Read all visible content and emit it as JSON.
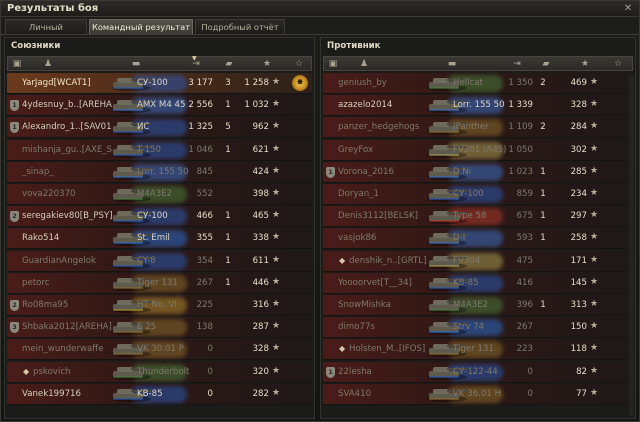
{
  "window": {
    "title": "Результаты боя",
    "close_glyph": "✕"
  },
  "tabs": [
    {
      "label": "Личный результат",
      "active": false
    },
    {
      "label": "Командный результат",
      "active": true
    },
    {
      "label": "Подробный отчёт",
      "active": false
    }
  ],
  "icons": {
    "platoon": "platoon-icon",
    "player": "player-icon",
    "tank": "tank-icon",
    "damage": "damage-icon",
    "kills": "kills-icon",
    "xp": "experience-star-icon",
    "star_glyph": "★",
    "medal": "medal-icon"
  },
  "colors": {
    "player_row": "#6b3a1c",
    "dead_row": "#4a1c18",
    "accent_text": "#e6dfc9",
    "tab_active": "#55534a"
  },
  "allies": {
    "title": "Союзники",
    "rows": [
      {
        "name": "YarJagd[WCAT1]",
        "platoon": "",
        "tank": "СУ-100",
        "nation": "ussr",
        "damage": "3 177",
        "kills": "3",
        "xp": "1 258",
        "player": true,
        "dead": false,
        "medal": true
      },
      {
        "name": "4ydesnuy_b..[AREHA]",
        "platoon": "1",
        "tank": "AMX M4 45",
        "nation": "france",
        "damage": "2 556",
        "kills": "1",
        "xp": "1 032",
        "player": false,
        "dead": false
      },
      {
        "name": "Alexandro_1..[SAV01]",
        "platoon": "1",
        "tank": "ИС",
        "nation": "ussr",
        "damage": "1 325",
        "kills": "5",
        "xp": "962",
        "player": false,
        "dead": false
      },
      {
        "name": "mishanja_gu..[AXE_S]",
        "platoon": "",
        "tank": "T-150",
        "nation": "ussr",
        "damage": "1 046",
        "kills": "1",
        "xp": "621",
        "player": false,
        "dead": true
      },
      {
        "name": "_sinap_",
        "platoon": "",
        "tank": "Lorr. 155 50",
        "nation": "france",
        "damage": "845",
        "kills": "",
        "xp": "424",
        "player": false,
        "dead": true
      },
      {
        "name": "vova220370",
        "platoon": "",
        "tank": "M4A3E2",
        "nation": "usa",
        "damage": "552",
        "kills": "",
        "xp": "398",
        "player": false,
        "dead": true
      },
      {
        "name": "seregakiev80[B_PSY]",
        "platoon": "2",
        "tank": "СУ-100",
        "nation": "ussr",
        "damage": "466",
        "kills": "1",
        "xp": "465",
        "player": false,
        "dead": false
      },
      {
        "name": "Rako514",
        "platoon": "",
        "tank": "St. Emil",
        "nation": "sweden",
        "damage": "355",
        "kills": "1",
        "xp": "338",
        "player": false,
        "dead": false
      },
      {
        "name": "GuardianAngelok",
        "platoon": "",
        "tank": "CY-8",
        "nation": "ussr",
        "damage": "354",
        "kills": "1",
        "xp": "611",
        "player": false,
        "dead": true
      },
      {
        "name": "petorc",
        "platoon": "",
        "tank": "Tiger 131",
        "nation": "germany",
        "damage": "267",
        "kills": "1",
        "xp": "446",
        "player": false,
        "dead": true
      },
      {
        "name": "Ro08ma95",
        "platoon": "2",
        "tank": "HT No. VI",
        "nation": "japan",
        "damage": "225",
        "kills": "",
        "xp": "316",
        "player": false,
        "dead": true
      },
      {
        "name": "Shbaka2012[AREHA]",
        "platoon": "3",
        "tank": "E 25",
        "nation": "germany",
        "damage": "138",
        "kills": "",
        "xp": "287",
        "player": false,
        "dead": true
      },
      {
        "name": "mein_wunderwaffe",
        "platoon": "",
        "tank": "VK 30.01 P",
        "nation": "germany",
        "damage": "0",
        "kills": "",
        "xp": "328",
        "player": false,
        "dead": true
      },
      {
        "name": "pskovich",
        "platoon": "",
        "tank": "Thunderbolt",
        "nation": "usa",
        "damage": "0",
        "kills": "",
        "xp": "320",
        "player": false,
        "dead": true,
        "skull": true
      },
      {
        "name": "Vanek199716",
        "platoon": "",
        "tank": "KB-85",
        "nation": "ussr",
        "damage": "0",
        "kills": "",
        "xp": "282",
        "player": false,
        "dead": false
      }
    ]
  },
  "enemies": {
    "title": "Противник",
    "rows": [
      {
        "name": "geniush_by",
        "platoon": "",
        "tank": "Hellcat",
        "nation": "usa",
        "damage": "1 350",
        "kills": "2",
        "xp": "469",
        "dead": true
      },
      {
        "name": "azazelo2014",
        "platoon": "",
        "tank": "Lorr. 155 50",
        "nation": "france",
        "damage": "1 339",
        "kills": "",
        "xp": "328",
        "dead": false
      },
      {
        "name": "panzer_hedgehogs",
        "platoon": "",
        "tank": "JPanther",
        "nation": "germany",
        "damage": "1 109",
        "kills": "2",
        "xp": "284",
        "dead": true
      },
      {
        "name": "GreyFox",
        "platoon": "",
        "tank": "FV201 (A45)",
        "nation": "uk",
        "damage": "1 050",
        "kills": "",
        "xp": "302",
        "dead": true
      },
      {
        "name": "Vorona_2016",
        "platoon": "1",
        "tank": "D.Ni",
        "nation": "france",
        "damage": "1 023",
        "kills": "1",
        "xp": "285",
        "dead": true
      },
      {
        "name": "Doryan_1",
        "platoon": "",
        "tank": "СУ-100",
        "nation": "ussr",
        "damage": "859",
        "kills": "1",
        "xp": "234",
        "dead": true
      },
      {
        "name": "Denis3112[BELSK]",
        "platoon": "",
        "tank": "Type 58",
        "nation": "china",
        "damage": "675",
        "kills": "1",
        "xp": "297",
        "dead": true
      },
      {
        "name": "vasjok86",
        "platoon": "",
        "tank": "D-I",
        "nation": "france",
        "damage": "593",
        "kills": "1",
        "xp": "258",
        "dead": true
      },
      {
        "name": "denshik_n..[GRTL]",
        "platoon": "",
        "tank": "FV304",
        "nation": "uk",
        "damage": "475",
        "kills": "",
        "xp": "171",
        "dead": true,
        "skull": true
      },
      {
        "name": "Yoooorvet[T__34]",
        "platoon": "",
        "tank": "KB-85",
        "nation": "ussr",
        "damage": "416",
        "kills": "",
        "xp": "145",
        "dead": true
      },
      {
        "name": "SnowMishka",
        "platoon": "",
        "tank": "M4A3E2",
        "nation": "usa",
        "damage": "396",
        "kills": "1",
        "xp": "313",
        "dead": true
      },
      {
        "name": "dimo77s",
        "platoon": "",
        "tank": "Strv 74",
        "nation": "sweden",
        "damage": "267",
        "kills": "",
        "xp": "150",
        "dead": true
      },
      {
        "name": "Holsten_M..[IFOS]",
        "platoon": "",
        "tank": "Tiger 131",
        "nation": "germany",
        "damage": "223",
        "kills": "",
        "xp": "118",
        "dead": true,
        "skull": true
      },
      {
        "name": "22lesha",
        "platoon": "1",
        "tank": "СУ-122-44",
        "nation": "ussr",
        "damage": "0",
        "kills": "",
        "xp": "82",
        "dead": true
      },
      {
        "name": "SVA410",
        "platoon": "",
        "tank": "VK 36.01 H",
        "nation": "germany",
        "damage": "0",
        "kills": "",
        "xp": "77",
        "dead": true
      }
    ]
  }
}
